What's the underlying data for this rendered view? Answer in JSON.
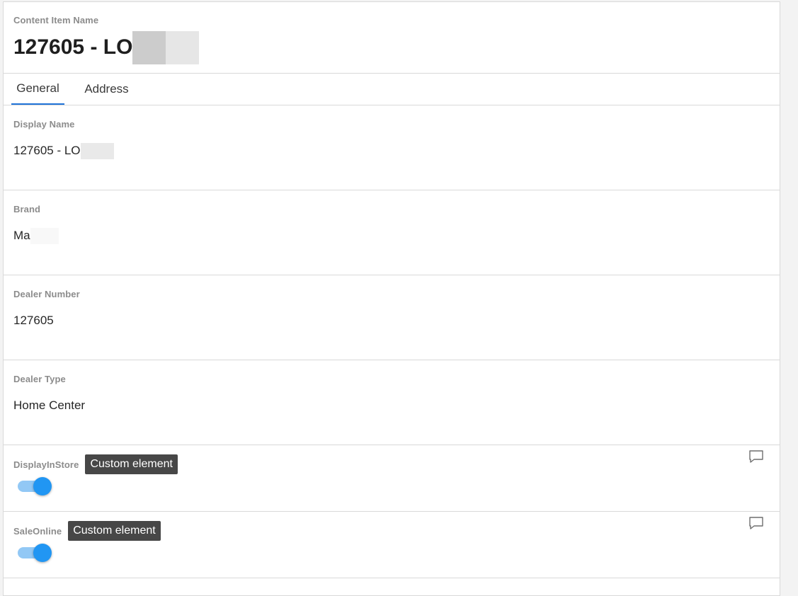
{
  "header": {
    "label": "Content Item Name",
    "title": "127605 - LO"
  },
  "tabs": [
    {
      "label": "General",
      "active": true
    },
    {
      "label": "Address",
      "active": false
    }
  ],
  "fields": {
    "display_name": {
      "label": "Display Name",
      "value": "127605 - LO"
    },
    "brand": {
      "label": "Brand",
      "value": "Ma"
    },
    "dealer_number": {
      "label": "Dealer Number",
      "value": "127605"
    },
    "dealer_type": {
      "label": "Dealer Type",
      "value": "Home Center"
    }
  },
  "toggles": {
    "display_in_store": {
      "label": "DisplayInStore",
      "tooltip": "Custom element",
      "checked": true
    },
    "sale_online": {
      "label": "SaleOnline",
      "tooltip": "Custom element",
      "checked": true
    }
  },
  "icons": {
    "comment": "comment-icon"
  },
  "colors": {
    "accent": "#1f73d8",
    "toggle_thumb": "#2196f3",
    "toggle_track": "#92c8f5",
    "tooltip_bg": "#474747"
  }
}
